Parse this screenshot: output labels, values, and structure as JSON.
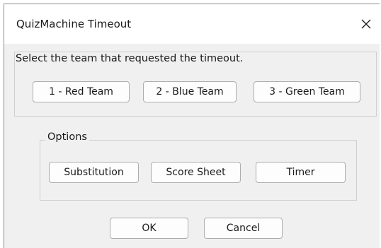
{
  "window": {
    "title": "QuizMachine Timeout",
    "close_icon": "close-icon"
  },
  "team_select": {
    "prompt": "Select the team that requested the timeout.",
    "buttons": [
      "1 - Red Team",
      "2 - Blue Team",
      "3 - Green Team"
    ]
  },
  "options": {
    "legend": "Options",
    "buttons": [
      "Substitution",
      "Score Sheet",
      "Timer"
    ]
  },
  "footer": {
    "ok_label": "OK",
    "cancel_label": "Cancel"
  }
}
